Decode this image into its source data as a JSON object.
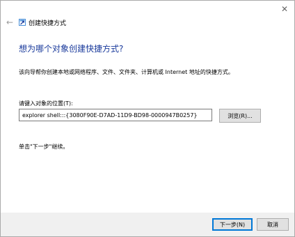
{
  "window": {
    "title": "创建快捷方式",
    "back_icon": "arrow-left-icon",
    "close_icon": "close-icon",
    "shortcut_icon": "shortcut-icon"
  },
  "main": {
    "heading": "想为哪个对象创建快捷方式?",
    "description": "该向导帮你创建本地或网络程序、文件、文件夹、计算机或 Internet 地址的快捷方式。",
    "location_label": "请键入对象的位置(T):",
    "location_value": "explorer shell:::{3080F90E-D7AD-11D9-BD98-0000947B0257}",
    "browse_label": "浏览(R)...",
    "hint": "单击\"下一步\"继续。"
  },
  "footer": {
    "next_label": "下一步(N)",
    "cancel_label": "取消"
  },
  "colors": {
    "heading": "#1b3b9c",
    "footer_bg": "#f0f0f0",
    "default_button_border": "#0078d7"
  }
}
